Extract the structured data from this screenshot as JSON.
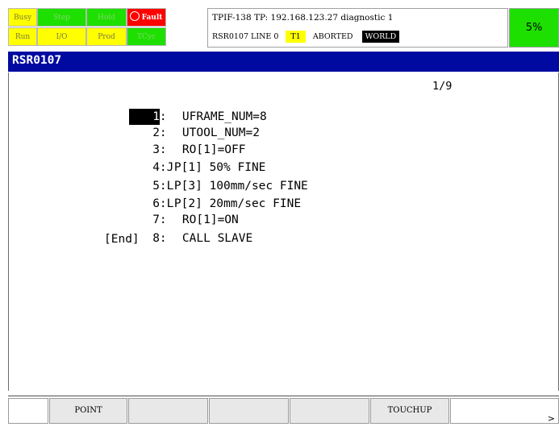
{
  "leds": {
    "busy": "Busy",
    "step": "Step",
    "hold": "Hold",
    "fault": "Fault",
    "run": "Run",
    "io": "I/O",
    "prod": "Prod",
    "tcyc": "TCyc"
  },
  "status": {
    "line1": "TPIF-138 TP: 192.168.123.27 diagnostic 1",
    "program": "RSR0107 LINE 0",
    "mode": "T1",
    "state": "ABORTED",
    "coord": "WORLD",
    "override": "5%"
  },
  "title": "RSR0107",
  "page_indicator": "1/9",
  "program_lines": [
    {
      "num": "1",
      "sep": ":",
      "text": "UFRAME_NUM=8"
    },
    {
      "num": "2",
      "sep": ":",
      "text": "UTOOL_NUM=2"
    },
    {
      "num": "3",
      "sep": ":",
      "text": "RO[1]=OFF"
    },
    {
      "num": "4",
      "sep": ":J",
      "text": "P[1] 50% FINE"
    },
    {
      "num": "5",
      "sep": ":L",
      "text": "P[3] 100mm/sec FINE"
    },
    {
      "num": "6",
      "sep": ":L",
      "text": "P[2] 20mm/sec FINE"
    },
    {
      "num": "7",
      "sep": ":",
      "text": "RO[1]=ON"
    },
    {
      "num": "8",
      "sep": ":",
      "text": "CALL SLAVE"
    }
  ],
  "end_marker": "[End]",
  "function_keys": [
    "",
    "POINT",
    "",
    "",
    "",
    "TOUCHUP",
    ">"
  ],
  "colors": {
    "title_bar": "#000aa0",
    "led_yellow": "#ffff00",
    "led_green": "#1ee000",
    "led_fault": "#ff0000"
  }
}
